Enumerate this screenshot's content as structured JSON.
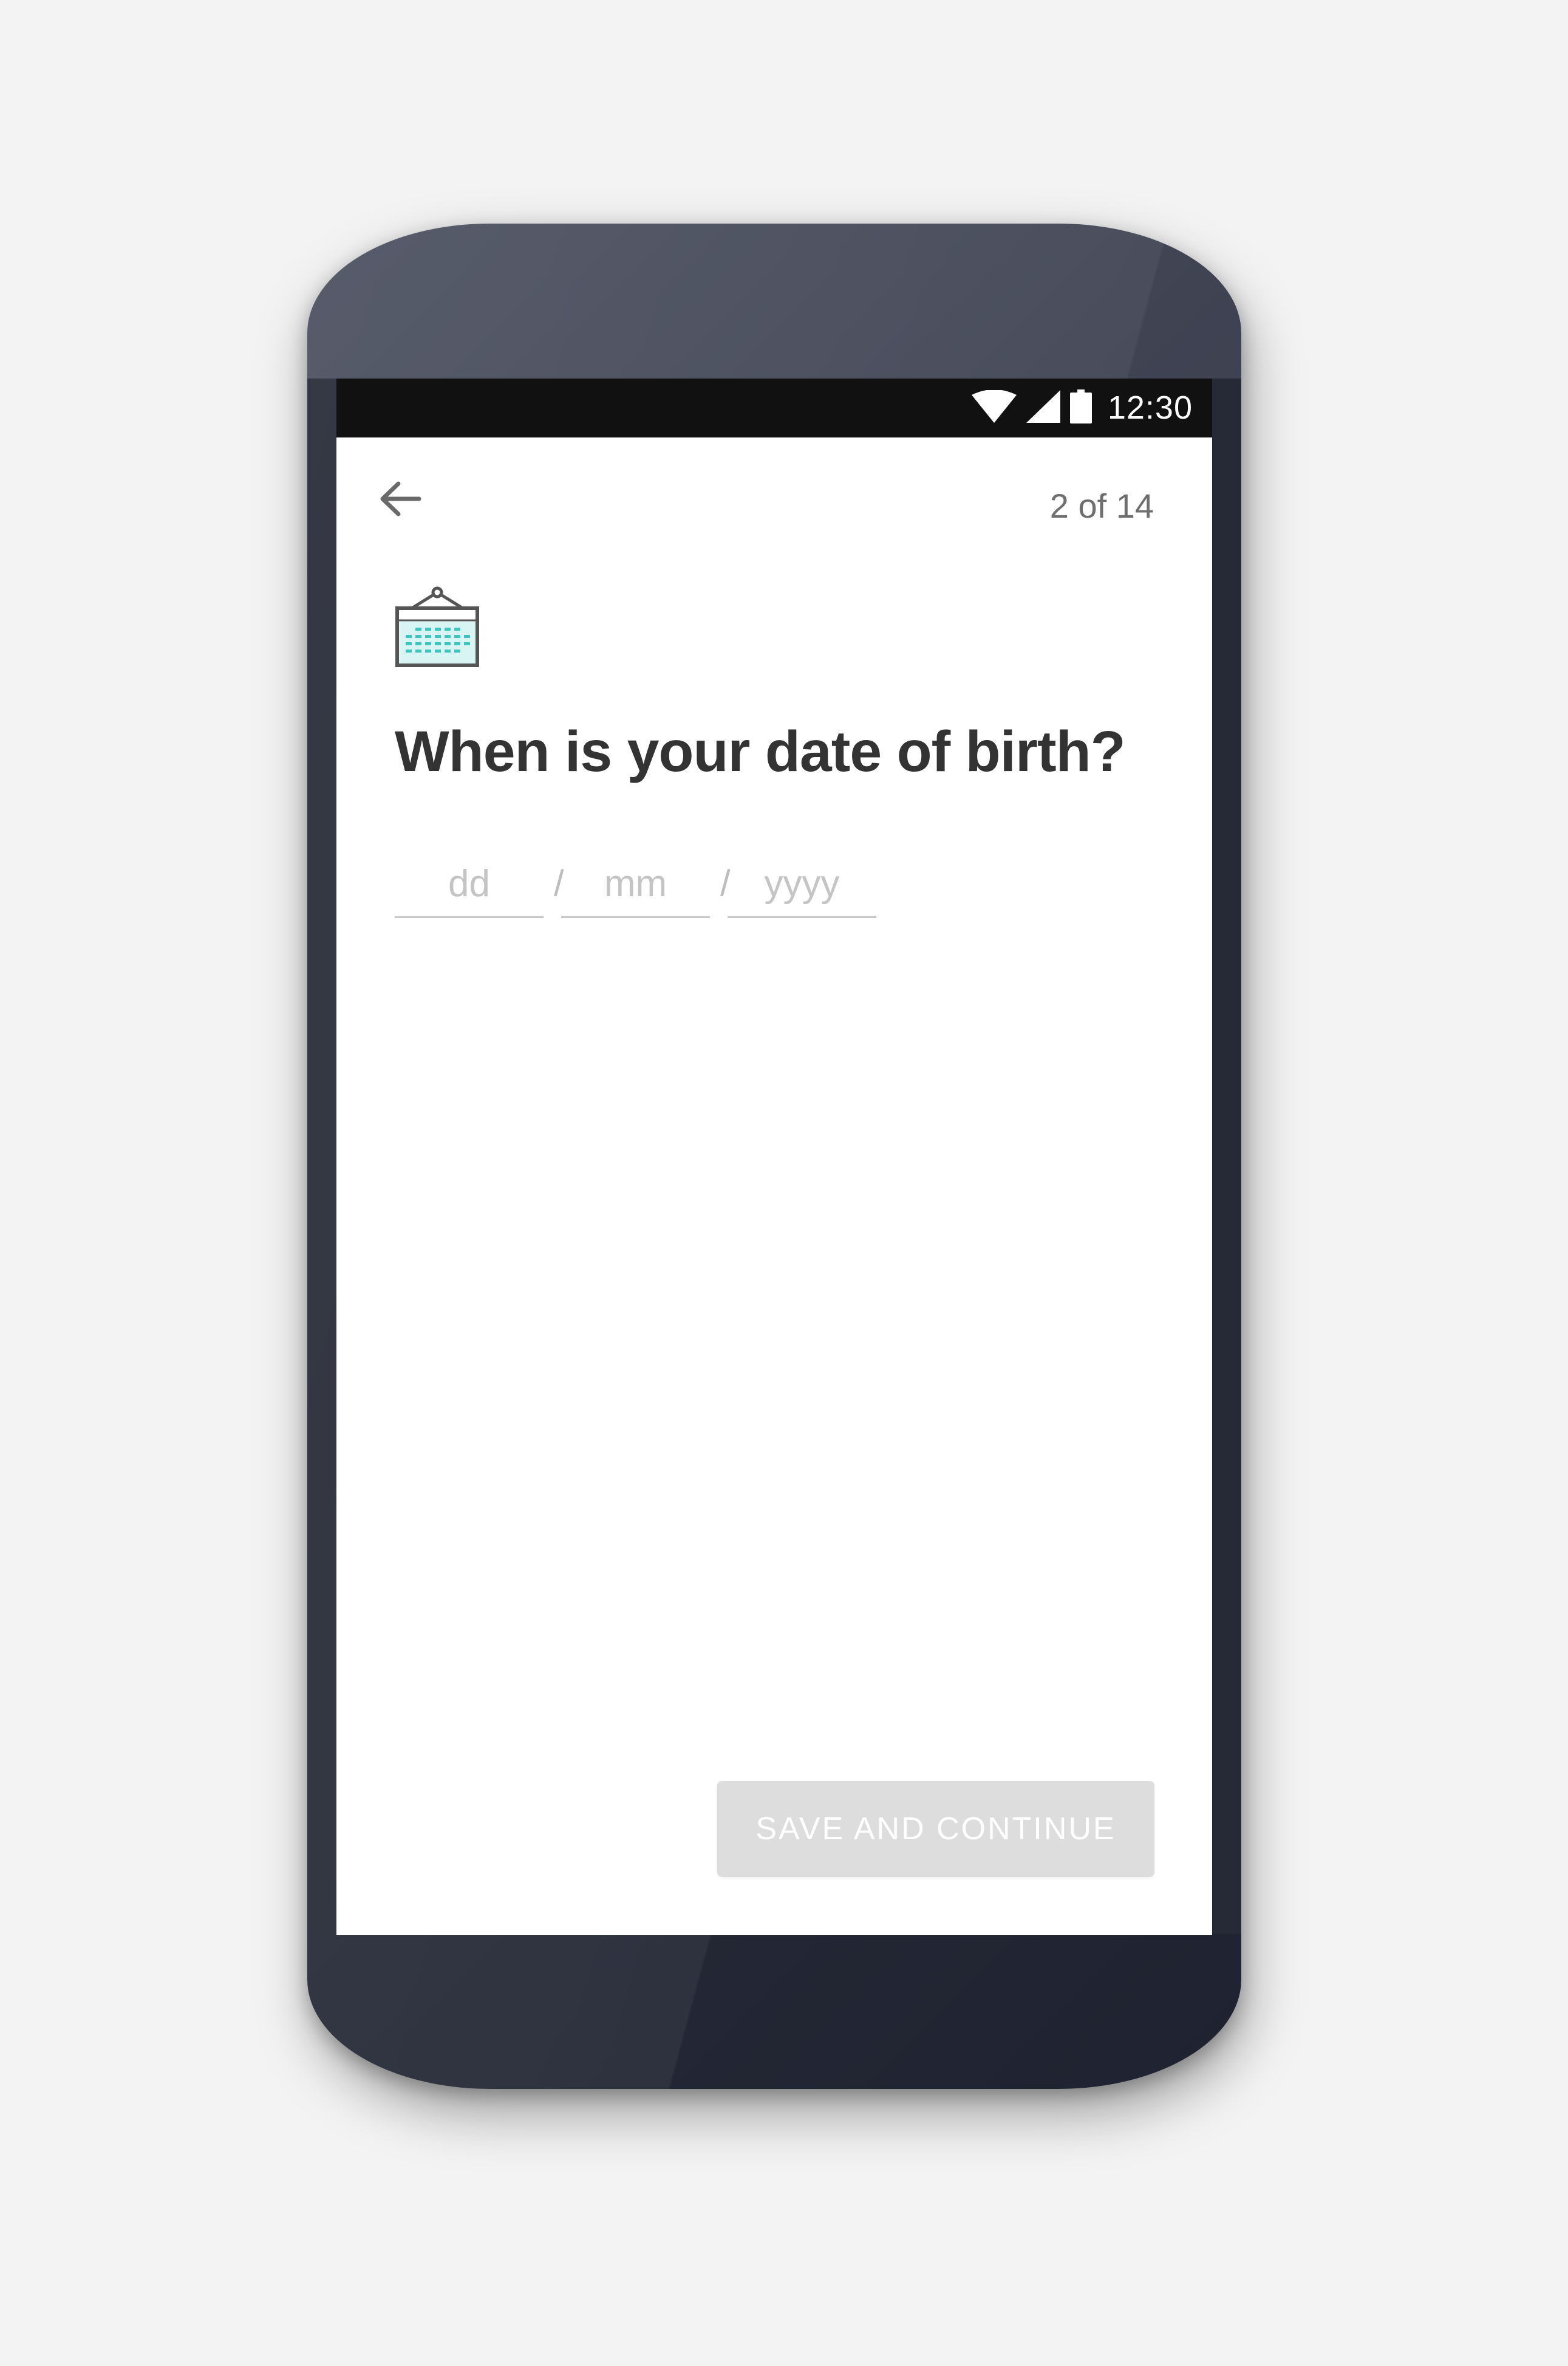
{
  "status_bar": {
    "time": "12:30",
    "icons": [
      "wifi-icon",
      "cellular-signal-icon",
      "battery-icon"
    ]
  },
  "header": {
    "back_icon": "arrow-back-icon",
    "step_counter": "2 of 14"
  },
  "question": {
    "icon": "calendar-icon",
    "title": "When is your date of birth?"
  },
  "date_of_birth": {
    "day_placeholder": "dd",
    "month_placeholder": "mm",
    "year_placeholder": "yyyy",
    "separator": "/"
  },
  "footer": {
    "primary_button_label": "SAVE AND CONTINUE"
  },
  "colors": {
    "phone_body": "#2a2e3b",
    "status_bar": "#111111",
    "screen": "#ffffff",
    "title_text": "#333333",
    "counter_text": "#6e6e6e",
    "placeholder_text": "#c4c4c4",
    "underline": "#c8c8c8",
    "button_disabled_bg": "#dddddd",
    "button_text": "#ffffff",
    "calendar_accent": "#3cc4c0",
    "calendar_stroke": "#555555"
  }
}
